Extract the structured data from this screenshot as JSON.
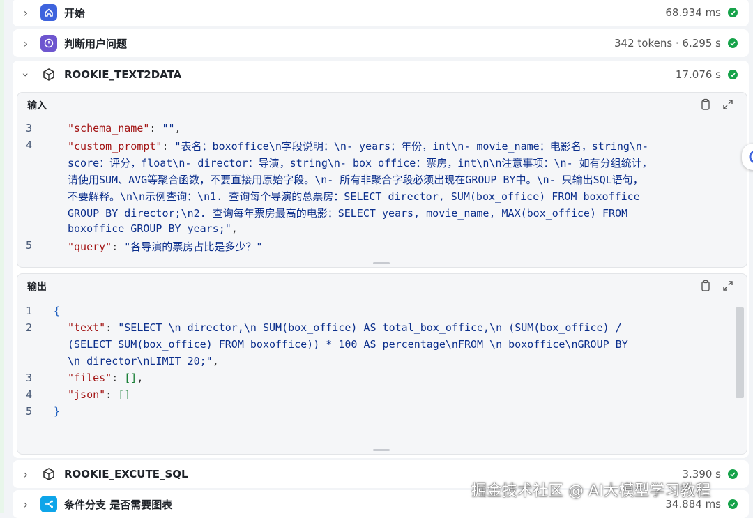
{
  "nodes": {
    "start": {
      "title": "开始",
      "meta": "68.934 ms"
    },
    "judge": {
      "title": "判断用户问题",
      "meta": "342 tokens · 6.295 s"
    },
    "text2data": {
      "title": "ROOKIE_TEXT2DATA",
      "meta": "17.076 s"
    },
    "execute_sql": {
      "title": "ROOKIE_EXCUTE_SQL",
      "meta": "3.390 s"
    },
    "branch": {
      "title": "条件分支 是否需要图表",
      "meta": "34.884 ms"
    }
  },
  "input_panel": {
    "label": "输入",
    "lines": [
      {
        "num": "3",
        "key": "\"schema_name\"",
        "sep": ": ",
        "value": "\"\"",
        "tail": ","
      },
      {
        "num": "4",
        "key": "\"custom_prompt\"",
        "sep": ": ",
        "value": "\"表名：boxoffice\\n字段说明：\\n- years：年份，int\\n- movie_name：电影名，string\\n-"
      },
      {
        "value": "score：评分，float\\n- director：导演，string\\n- box_office：票房，int\\n\\n注意事项：\\n- 如有分组统计，"
      },
      {
        "value": "请使用SUM、AVG等聚合函数，不要直接用原始字段。\\n- 所有非聚合字段必须出现在GROUP BY中。\\n- 只输出SQL语句，"
      },
      {
        "value": "不要解释。\\n\\n示例查询：\\n1. 查询每个导演的总票房：SELECT director, SUM(box_office) FROM boxoffice"
      },
      {
        "value": "GROUP BY director;\\n2. 查询每年票房最高的电影：SELECT years, movie_name, MAX(box_office) FROM"
      },
      {
        "value": "boxoffice GROUP BY years;\"",
        "tail": ","
      },
      {
        "num": "5",
        "key": "\"query\"",
        "sep": ": ",
        "value": "\"各导演的票房占比是多少？\""
      }
    ]
  },
  "output_panel": {
    "label": "输出",
    "open_brace": "{",
    "close_brace": "}",
    "nums": [
      "1",
      "2",
      "3",
      "4",
      "5"
    ],
    "text_key": "\"text\"",
    "text_lines": [
      "\"SELECT \\n    director,\\n    SUM(box_office) AS total_box_office,\\n    (SUM(box_office) /",
      "(SELECT SUM(box_office) FROM boxoffice)) * 100 AS percentage\\nFROM \\n    boxoffice\\nGROUP BY",
      "\\n    director\\nLIMIT 20;\""
    ],
    "files_key": "\"files\"",
    "files_value": "[]",
    "json_key": "\"json\"",
    "json_value": "[]"
  },
  "watermark": "掘金技术社区 @ AI大模型学习教程",
  "colors": {
    "ok_green": "#16a34a",
    "brand_blue": "#3e63dd",
    "icon_purple": "#6e56cf"
  },
  "icons": {
    "start": "home-icon",
    "judge": "question-classifier-icon",
    "tool": "toolbox-icon",
    "branch": "if-else-branch-icon",
    "copy": "copy-icon",
    "expand": "expand-icon",
    "status": "check-circle-icon"
  }
}
